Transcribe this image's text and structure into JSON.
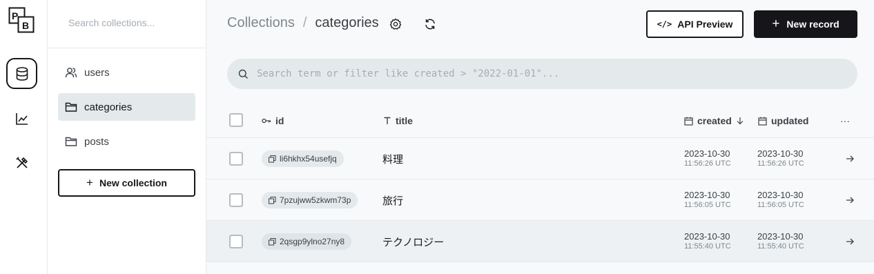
{
  "rail": {
    "logo_letters": [
      "P",
      "B"
    ],
    "items": [
      {
        "icon": "database-icon",
        "active": true
      },
      {
        "icon": "chart-line-icon",
        "active": false
      },
      {
        "icon": "tools-icon",
        "active": false
      }
    ]
  },
  "sidebar": {
    "search_placeholder": "Search collections...",
    "items": [
      {
        "label": "users",
        "icon": "users-icon",
        "active": false
      },
      {
        "label": "categories",
        "icon": "folder-icon",
        "active": true
      },
      {
        "label": "posts",
        "icon": "folder-icon",
        "active": false
      }
    ],
    "new_collection_label": "New collection"
  },
  "header": {
    "breadcrumb_root": "Collections",
    "breadcrumb_sep": "/",
    "breadcrumb_current": "categories",
    "api_preview_code": "</>",
    "api_preview_label": "API Preview",
    "new_record_label": "New record"
  },
  "search": {
    "placeholder": "Search term or filter like created > \"2022-01-01\"..."
  },
  "table": {
    "columns": {
      "id": "id",
      "title": "title",
      "created": "created",
      "updated": "updated",
      "more": "···"
    },
    "rows": [
      {
        "id": "li6hkhx54usefjq",
        "title": "料理",
        "created_date": "2023-10-30",
        "created_time": "11:56:26 UTC",
        "updated_date": "2023-10-30",
        "updated_time": "11:56:26 UTC"
      },
      {
        "id": "7pzujww5zkwm73p",
        "title": "旅行",
        "created_date": "2023-10-30",
        "created_time": "11:56:05 UTC",
        "updated_date": "2023-10-30",
        "updated_time": "11:56:05 UTC"
      },
      {
        "id": "2qsgp9ylno27ny8",
        "title": "テクノロジー",
        "created_date": "2023-10-30",
        "created_time": "11:55:40 UTC",
        "updated_date": "2023-10-30",
        "updated_time": "11:55:40 UTC"
      }
    ]
  },
  "colors": {
    "accent": "#16161a",
    "sidebar_active": "#e4e9ec",
    "main_bg": "#f8f9fa"
  }
}
